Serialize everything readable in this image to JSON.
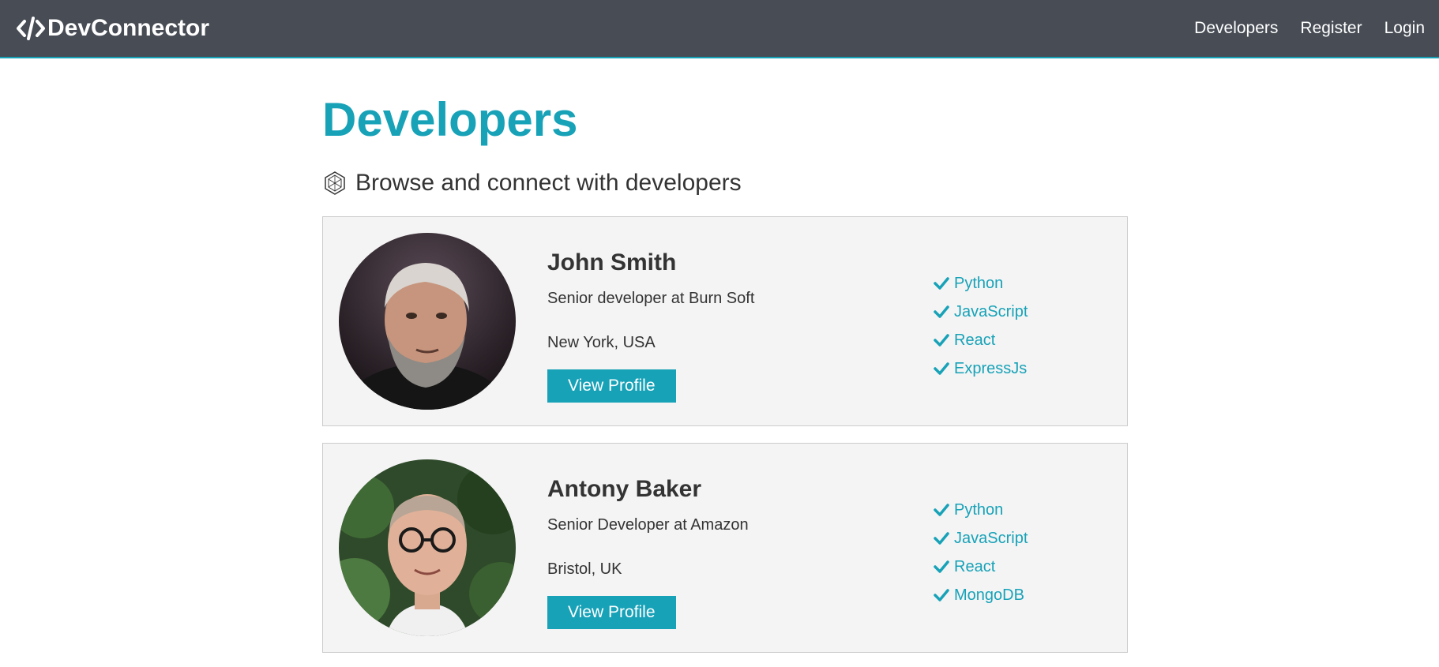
{
  "navbar": {
    "brand": "DevConnector",
    "links": [
      "Developers",
      "Register",
      "Login"
    ]
  },
  "page": {
    "title": "Developers",
    "lead": "Browse and connect with developers"
  },
  "profiles": [
    {
      "name": "John Smith",
      "status": "Senior developer at Burn Soft",
      "location": "New York, USA",
      "button": "View Profile",
      "skills": [
        "Python",
        "JavaScript",
        "React",
        "ExpressJs"
      ]
    },
    {
      "name": "Antony Baker",
      "status": "Senior Developer at Amazon",
      "location": "Bristol, UK",
      "button": "View Profile",
      "skills": [
        "Python",
        "JavaScript",
        "React",
        "MongoDB"
      ]
    }
  ],
  "colors": {
    "primary": "#17a2b8",
    "navbar": "#474c55",
    "card": "#f4f4f4"
  },
  "icons": [
    "code-icon",
    "hub-icon",
    "check-icon"
  ]
}
